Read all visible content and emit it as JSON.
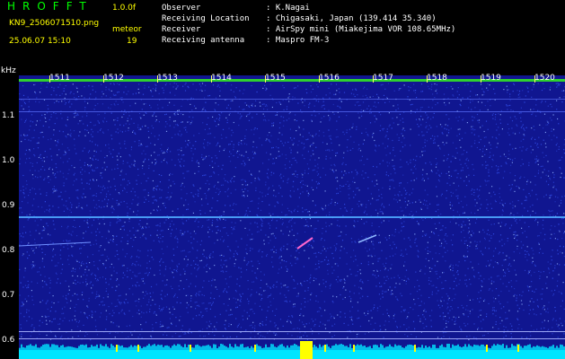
{
  "header": {
    "app_title": "HROFFT",
    "version": "1.0.0f",
    "filename": "KN9_2506071510.png",
    "mode": "meteor",
    "datetime": "25.06.07 15:10",
    "count": "19"
  },
  "info": [
    {
      "label": "Observer",
      "value": ": K.Nagai"
    },
    {
      "label": "Receiving Location",
      "value": ": Chigasaki, Japan (139.414 35.340)"
    },
    {
      "label": "Receiver",
      "value": ": AirSpy mini (Miakejima VOR 108.65MHz)"
    },
    {
      "label": "Receiving antenna",
      "value": ": Maspro FM-3"
    }
  ],
  "spectrogram": {
    "unit_label": "kHz",
    "y_ticks": [
      "1.1",
      "1.0",
      "0.9",
      "0.8",
      "0.7",
      "0.6"
    ],
    "time_ticks": [
      "1511",
      "1512",
      "1513",
      "1514",
      "1515",
      "1516",
      "1517",
      "1518",
      "1519",
      "1520"
    ],
    "colors": {
      "background": "#101690",
      "noise": "#3a5cff",
      "signal": "#ff66cc",
      "baseline": "#00e5ff",
      "burst": "#ffff00"
    }
  }
}
